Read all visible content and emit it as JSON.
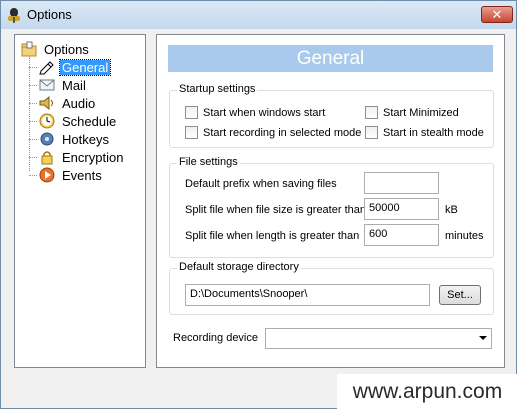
{
  "window": {
    "title": "Options",
    "close_label": "✕"
  },
  "tree": {
    "root": "Options",
    "items": [
      {
        "label": "General",
        "icon": "pen-icon",
        "selected": true
      },
      {
        "label": "Mail",
        "icon": "mail-icon"
      },
      {
        "label": "Audio",
        "icon": "speaker-icon"
      },
      {
        "label": "Schedule",
        "icon": "clock-icon"
      },
      {
        "label": "Hotkeys",
        "icon": "hotkey-icon"
      },
      {
        "label": "Encryption",
        "icon": "lock-icon"
      },
      {
        "label": "Events",
        "icon": "play-icon"
      }
    ]
  },
  "panel": {
    "header": "General",
    "startup": {
      "title": "Startup settings",
      "start_windows": "Start when windows start",
      "start_minimized": "Start Minimized",
      "start_recording": "Start recording in selected mode",
      "start_stealth": "Start in stealth mode"
    },
    "files": {
      "title": "File settings",
      "prefix_label": "Default prefix when saving files",
      "prefix_value": "",
      "size_label": "Split file when file size is greater than",
      "size_value": "50000",
      "size_unit": "kB",
      "length_label": "Split file when length is greater than",
      "length_value": "600",
      "length_unit": "minutes"
    },
    "storage": {
      "title": "Default storage directory",
      "path": "D:\\Documents\\Snooper\\",
      "set_button": "Set..."
    },
    "recording_device": {
      "label": "Recording device",
      "value": ""
    }
  },
  "watermark": "www.arpun.com",
  "colors": {
    "header_bg": "#a9c9ed",
    "selection": "#3399ff"
  }
}
